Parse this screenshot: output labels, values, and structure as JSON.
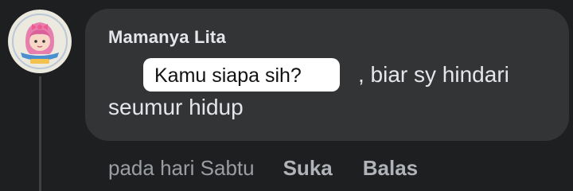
{
  "comment": {
    "author": "Mamanya Lita",
    "mention": "Kamu siapa sih?",
    "text_line1_rest": ", biar sy hindari",
    "text_line2": "seumur hidup"
  },
  "actions": {
    "timestamp": "pada hari Sabtu",
    "like_label": "Suka",
    "reply_label": "Balas"
  },
  "colors": {
    "background": "#1e1f21",
    "bubble": "#333436",
    "text": "#e4e6eb",
    "muted_text": "#b0b3b8",
    "mention_box": "#ffffff"
  },
  "icons": {
    "avatar": "profile-avatar-cartoon-girl"
  }
}
